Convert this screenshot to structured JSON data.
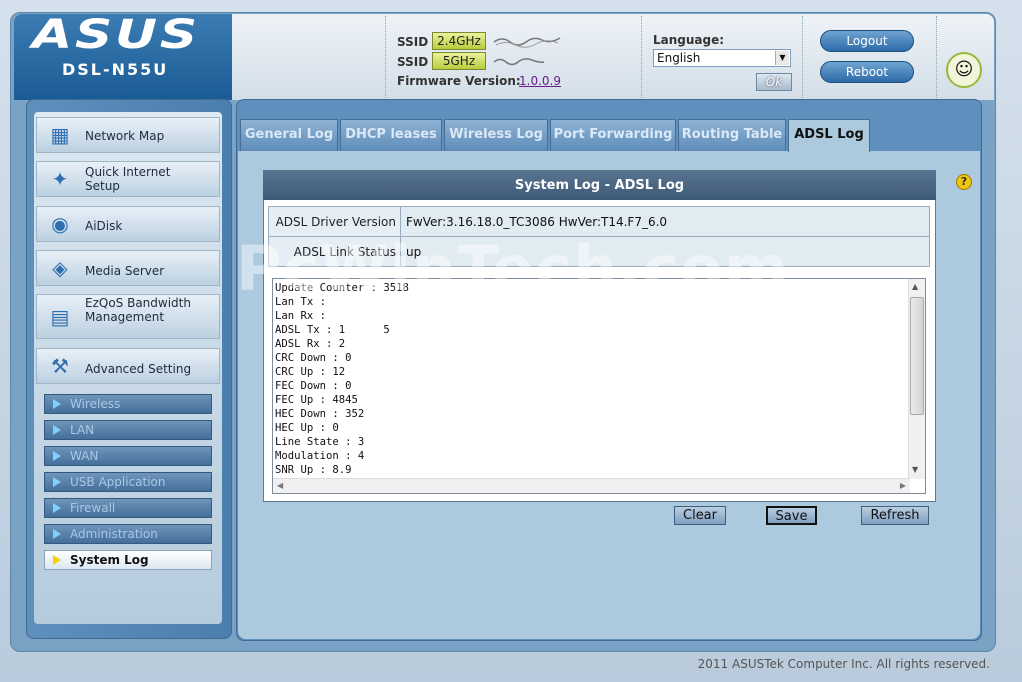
{
  "header": {
    "brand": "ASUS",
    "model": "DSL-N55U",
    "ssid_label": "SSID",
    "band_24": "2.4GHz",
    "band_5": "5GHz",
    "firmware_label": "Firmware Version:",
    "firmware_version": "1.0.0.9",
    "language_label": "Language:",
    "language_value": "English",
    "ok_label": "Ok",
    "logout_label": "Logout",
    "reboot_label": "Reboot"
  },
  "sidebar": {
    "items": [
      {
        "label": "Network Map",
        "icon": "network-map-icon"
      },
      {
        "label": "Quick Internet Setup",
        "icon": "magic-wand-icon"
      },
      {
        "label": "AiDisk",
        "icon": "disk-icon"
      },
      {
        "label": "Media Server",
        "icon": "media-server-icon"
      },
      {
        "label": "EzQoS Bandwidth Management",
        "icon": "qos-icon"
      },
      {
        "label": "Advanced Setting",
        "icon": "tools-icon"
      }
    ],
    "subitems": [
      "Wireless",
      "LAN",
      "WAN",
      "USB Application",
      "Firewall",
      "Administration",
      "System Log"
    ]
  },
  "tabs": [
    "General Log",
    "DHCP leases",
    "Wireless Log",
    "Port Forwarding",
    "Routing Table",
    "ADSL Log"
  ],
  "panel": {
    "title": "System Log - ADSL Log",
    "rows": [
      {
        "label": "ADSL Driver Version",
        "value": "FwVer:3.16.18.0_TC3086 HwVer:T14.F7_6.0"
      },
      {
        "label": "ADSL Link Status",
        "value": "up"
      }
    ],
    "log_text": "Update Counter : 3518\nLan Tx : \nLan Rx : \nADSL Tx : 1      5\nADSL Rx : 2\nCRC Down : 0\nCRC Up : 12\nFEC Down : 0\nFEC Up : 4845\nHEC Down : 352\nHEC Up : 0\nLine State : 3\nModulation : 4\nSNR Up : 8.9"
  },
  "buttons": {
    "clear": "Clear",
    "save": "Save",
    "refresh": "Refresh"
  },
  "footer": "2011 ASUSTek Computer Inc. All rights reserved.",
  "watermark": "PcWinTech.com"
}
